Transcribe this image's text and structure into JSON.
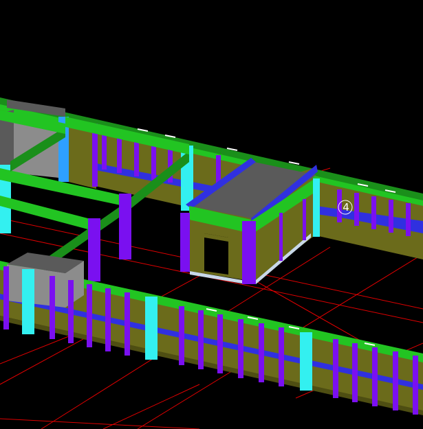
{
  "viewport": {
    "background": "#000000",
    "axis_marker": "4"
  },
  "colors": {
    "grid_line": "#e00000",
    "wall_olive": "#6b6b1b",
    "wall_olive_dark": "#4e4e12",
    "beam_green": "#22c422",
    "beam_green_dark": "#1a8f1a",
    "column_purple": "#7a10f0",
    "column_purple_dark": "#5408b0",
    "column_cyan": "#33f0f0",
    "beam_blue": "#3030e0",
    "slab_gray": "#5a5a5a",
    "wall_gray": "#8c8c8c",
    "edge_light": "#c8d8e8"
  }
}
